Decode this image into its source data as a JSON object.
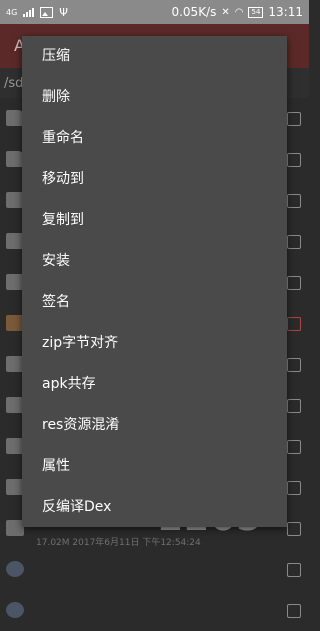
{
  "status_bar": {
    "network": "4G",
    "speed": "0.05K/s",
    "battery": "54",
    "time": "13:11"
  },
  "background": {
    "app_title_partial": "A",
    "path_partial": "/sdc",
    "footer": "17.02M   2017年6月11日 下午12:54:24",
    "rows": [
      {
        "icon": "folder-icon",
        "checked": false
      },
      {
        "icon": "folder-icon",
        "checked": false
      },
      {
        "icon": "file-icon",
        "checked": false
      },
      {
        "icon": "file-icon",
        "checked": false
      },
      {
        "icon": "file-icon",
        "checked": false
      },
      {
        "icon": "apk-icon",
        "checked": true
      },
      {
        "icon": "file-icon",
        "checked": false
      },
      {
        "icon": "file-icon",
        "checked": false
      },
      {
        "icon": "file-icon",
        "checked": false
      },
      {
        "icon": "file-icon",
        "checked": false
      },
      {
        "icon": "file-icon",
        "checked": false
      },
      {
        "icon": "plugin-icon",
        "checked": false
      },
      {
        "icon": "plugin-icon",
        "checked": false
      }
    ]
  },
  "watermark": {
    "text": "2265",
    "sub": "手游"
  },
  "menu": {
    "items": [
      "压缩",
      "删除",
      "重命名",
      "移动到",
      "复制到",
      "安装",
      "签名",
      "zip字节对齐",
      "apk共存",
      "res资源混淆",
      "属性",
      "反编译Dex"
    ]
  }
}
